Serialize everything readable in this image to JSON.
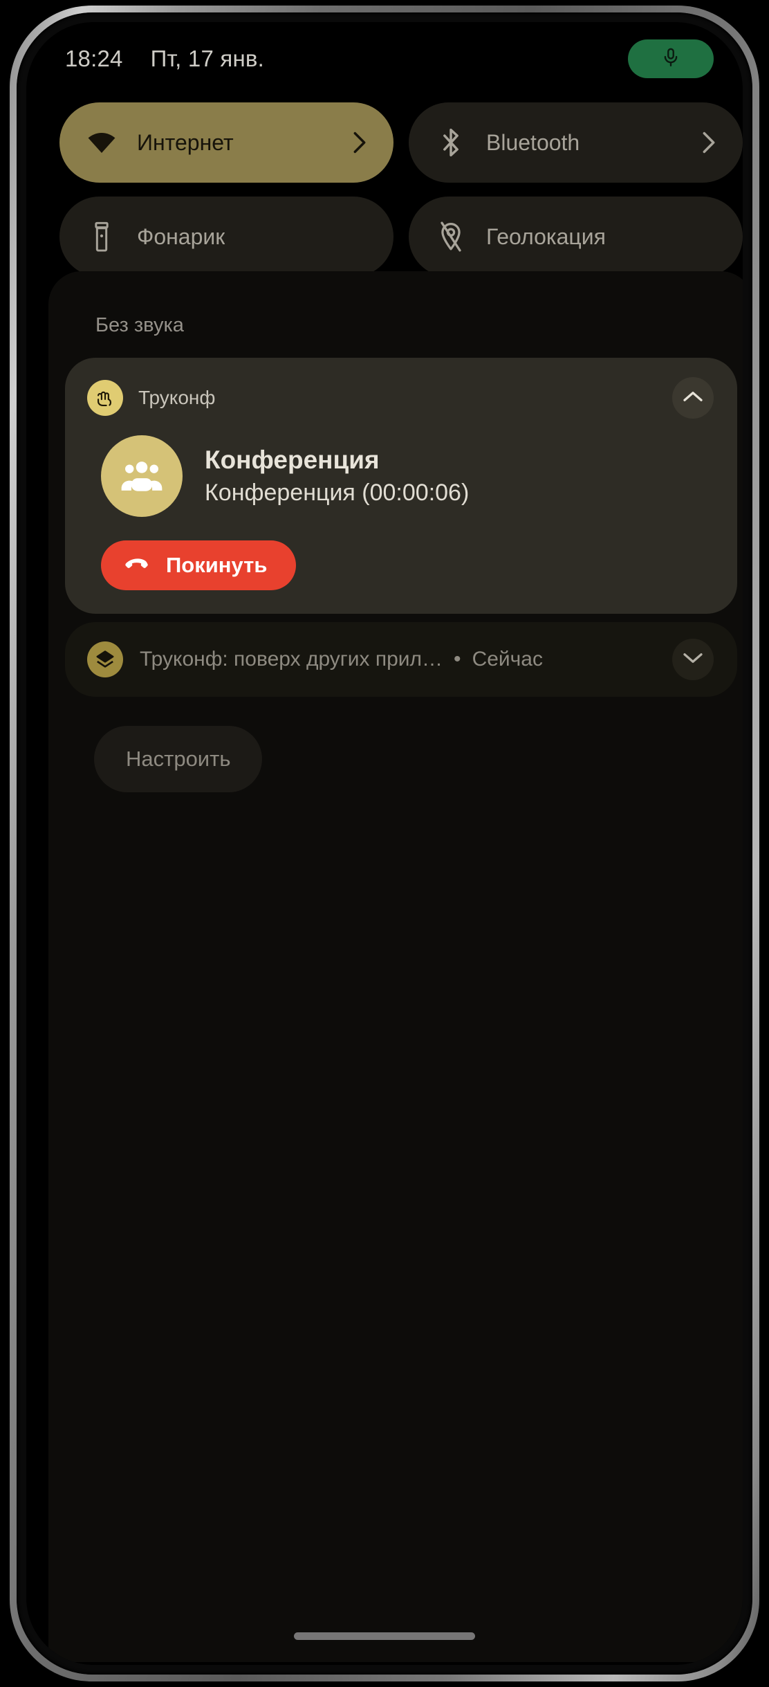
{
  "status_bar": {
    "time": "18:24",
    "date": "Пт, 17 янв.",
    "mic_indicator_icon": "microphone-icon",
    "mic_indicator_color": "#1f7041"
  },
  "quick_settings": {
    "tiles": [
      {
        "label": "Интернет",
        "icon": "wifi-icon",
        "active": true,
        "has_chevron": true,
        "active_color": "#8a7d4a"
      },
      {
        "label": "Bluetooth",
        "icon": "bluetooth-icon",
        "active": false,
        "has_chevron": true
      },
      {
        "label": "Фонарик",
        "icon": "flashlight-icon",
        "active": false,
        "has_chevron": false
      },
      {
        "label": "Геолокация",
        "icon": "location-off-icon",
        "active": false,
        "has_chevron": false
      }
    ]
  },
  "shade": {
    "section_title": "Без звука",
    "notification": {
      "app_icon": "truconf-app-icon",
      "app_name": "Труконф",
      "collapse_icon": "chevron-up-icon",
      "avatar_icon": "group-people-icon",
      "title": "Конференция",
      "subtitle": "Конференция (00:00:06)",
      "action": {
        "label": "Покинуть",
        "icon": "hangup-phone-icon",
        "color": "#e8412e"
      }
    },
    "collapsed_notification": {
      "app_icon": "layers-icon",
      "text": "Труконф: поверх других прил…",
      "separator": "•",
      "time": "Сейчас",
      "expand_icon": "chevron-down-icon"
    },
    "manage_label": "Настроить"
  },
  "navigation": {
    "gesture_bar": "home-gesture-bar"
  }
}
